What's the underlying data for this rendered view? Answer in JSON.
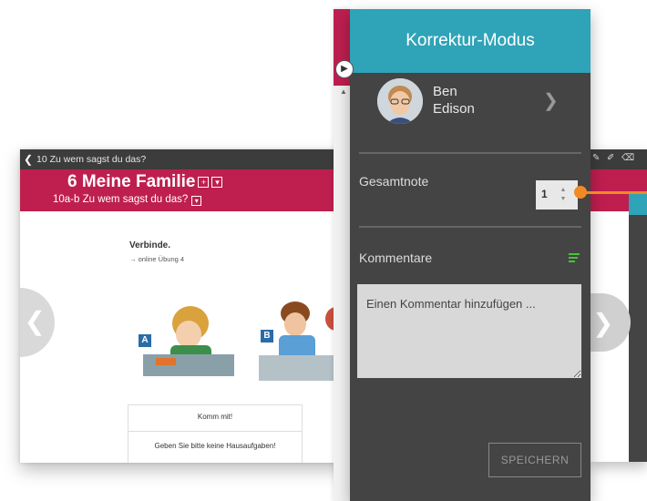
{
  "book": {
    "breadcrumb": "10 Zu wem sagst du das?",
    "title": "6 Meine Familie",
    "subtitle": "10a-b Zu wem sagst du das?",
    "instruction": "Verbinde.",
    "online_ref": "→ online Übung 4",
    "image_labels": [
      "A",
      "B"
    ],
    "box_title": "Komm mit!",
    "box_item": "Geben Sie bitte keine Hausaufgaben!"
  },
  "panel": {
    "title": "Korrektur-Modus",
    "student_first": "Ben",
    "student_last": "Edison",
    "grade_label": "Gesamtnote",
    "grade_value": "1",
    "comments_label": "Kommentare",
    "comment_placeholder": "Einen Kommentar hinzufügen ...",
    "save_label": "SPEICHERN"
  },
  "colors": {
    "accent_teal": "#2fa3b7",
    "book_red": "#be1f4f",
    "panel_dark": "#444444",
    "highlight_orange": "#f08a24",
    "comment_icon_green": "#4ac13d"
  }
}
